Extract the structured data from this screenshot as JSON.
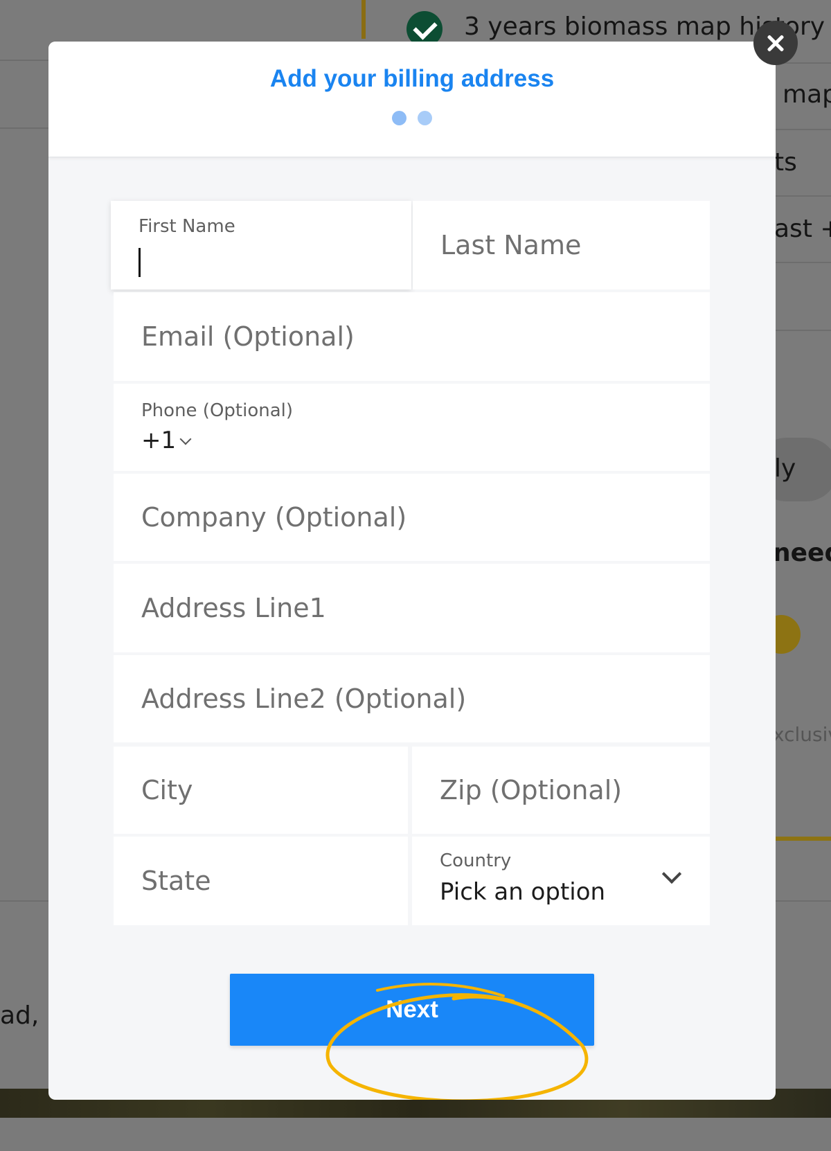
{
  "background": {
    "feature_1": "3 years biomass map history",
    "feature_2_fragment": "map",
    "feature_3_fragment": "ts",
    "feature_4_fragment": "ast +",
    "pill_fragment": "ly",
    "heading_fragment": "need",
    "exclusive_fragment": "xclusiv",
    "address_fragment": "ad, N"
  },
  "modal": {
    "title": "Add your billing address",
    "steps_total": 2,
    "steps_active": 1
  },
  "form": {
    "first_name": {
      "label": "First Name",
      "value": ""
    },
    "last_name": {
      "placeholder": "Last Name"
    },
    "email": {
      "placeholder": "Email (Optional)"
    },
    "phone": {
      "label": "Phone (Optional)",
      "country_code": "+1"
    },
    "company": {
      "placeholder": "Company (Optional)"
    },
    "address_line1": {
      "placeholder": "Address Line1"
    },
    "address_line2": {
      "placeholder": "Address Line2 (Optional)"
    },
    "city": {
      "placeholder": "City"
    },
    "zip": {
      "placeholder": "Zip (Optional)"
    },
    "state": {
      "placeholder": "State"
    },
    "country": {
      "label": "Country",
      "value": "Pick an option"
    }
  },
  "actions": {
    "next_label": "Next",
    "close_icon": "close-icon"
  },
  "colors": {
    "accent": "#1987f8",
    "title": "#1a84f0",
    "annotation": "#f5b400"
  }
}
